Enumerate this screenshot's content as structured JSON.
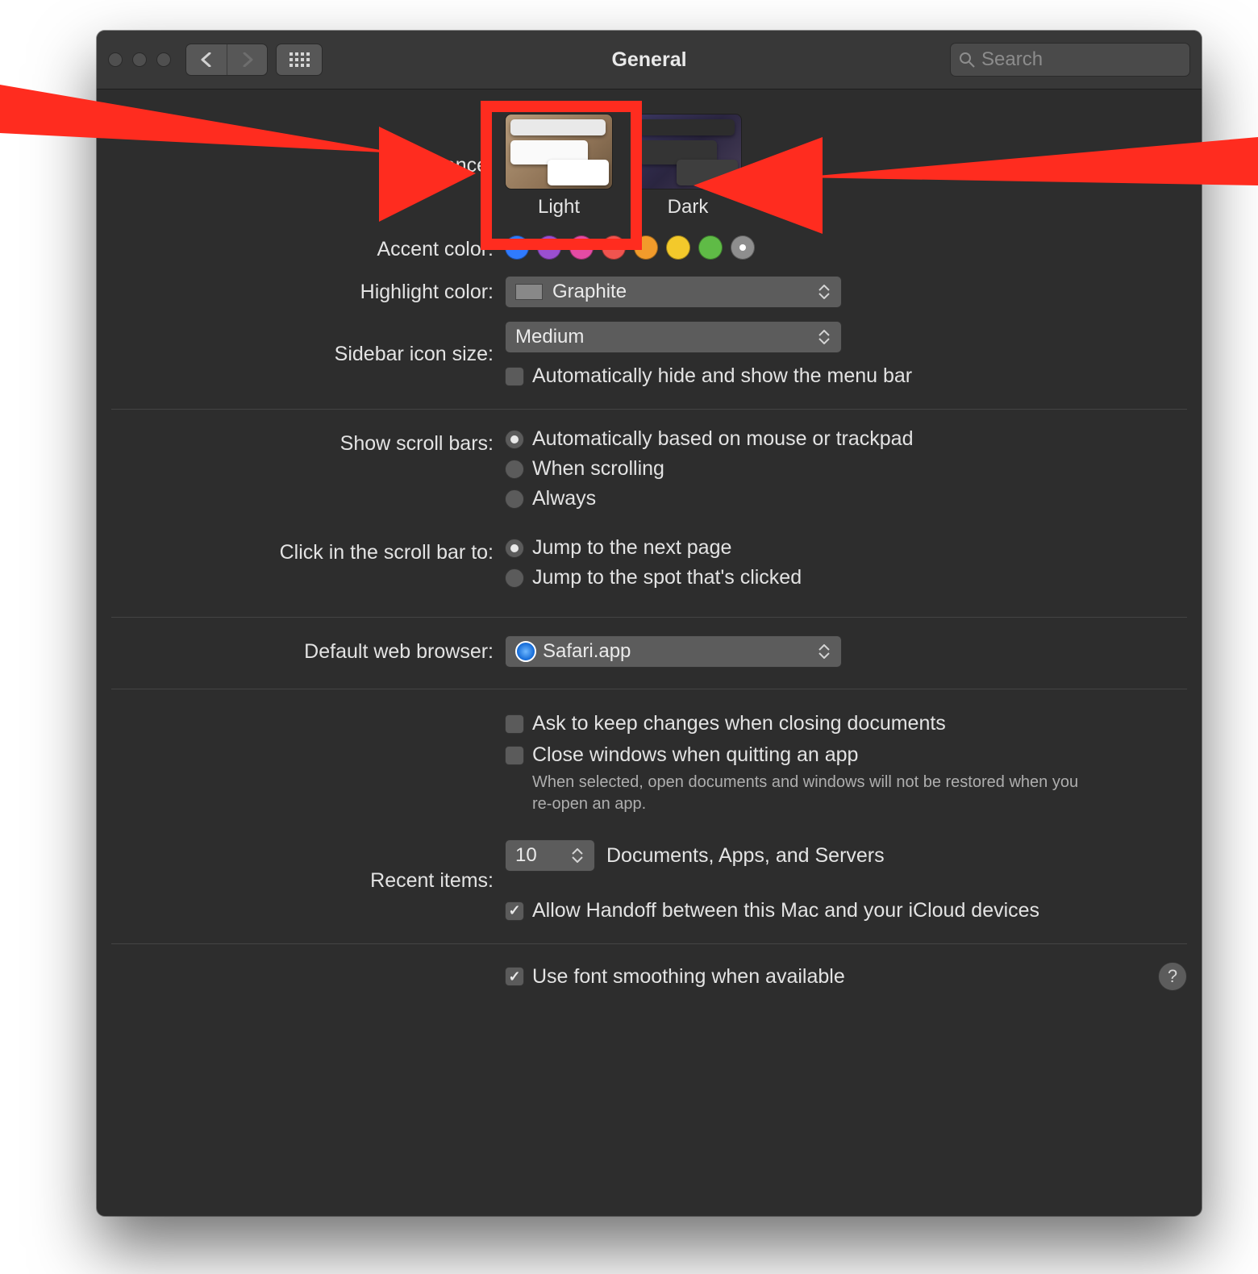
{
  "window": {
    "title": "General"
  },
  "search": {
    "placeholder": "Search"
  },
  "labels": {
    "appearance": "Appearance:",
    "accent": "Accent color:",
    "highlight": "Highlight color:",
    "sidebar_size": "Sidebar icon size:",
    "scrollbars": "Show scroll bars:",
    "click_scroll": "Click in the scroll bar to:",
    "default_browser": "Default web browser:",
    "recent_items": "Recent items:"
  },
  "appearance": {
    "options": [
      {
        "id": "light",
        "label": "Light",
        "highlighted": true
      },
      {
        "id": "dark",
        "label": "Dark",
        "highlighted": false
      }
    ]
  },
  "accent_colors": [
    {
      "color": "#2f7bff",
      "selected": false
    },
    {
      "color": "#9a4fd1",
      "selected": false
    },
    {
      "color": "#e44ba4",
      "selected": false
    },
    {
      "color": "#f0544f",
      "selected": false
    },
    {
      "color": "#f29b2b",
      "selected": false
    },
    {
      "color": "#f3c92b",
      "selected": false
    },
    {
      "color": "#5fbb46",
      "selected": false
    },
    {
      "color": "#8e8e8e",
      "selected": true
    }
  ],
  "highlight": {
    "value": "Graphite"
  },
  "sidebar_size": {
    "value": "Medium"
  },
  "auto_hide_menubar": {
    "label": "Automatically hide and show the menu bar",
    "checked": false
  },
  "scrollbars": {
    "options": [
      {
        "label": "Automatically based on mouse or trackpad",
        "selected": true
      },
      {
        "label": "When scrolling",
        "selected": false
      },
      {
        "label": "Always",
        "selected": false
      }
    ]
  },
  "click_scroll": {
    "options": [
      {
        "label": "Jump to the next page",
        "selected": true
      },
      {
        "label": "Jump to the spot that's clicked",
        "selected": false
      }
    ]
  },
  "default_browser": {
    "value": "Safari.app"
  },
  "documents": {
    "ask_keep_changes": {
      "label": "Ask to keep changes when closing documents",
      "checked": false
    },
    "close_windows": {
      "label": "Close windows when quitting an app",
      "help": "When selected, open documents and windows will not be restored when you re-open an app.",
      "checked": false
    }
  },
  "recent_items": {
    "value": "10",
    "suffix": "Documents, Apps, and Servers"
  },
  "handoff": {
    "label": "Allow Handoff between this Mac and your iCloud devices",
    "checked": true
  },
  "font_smoothing": {
    "label": "Use font smoothing when available",
    "checked": true
  }
}
